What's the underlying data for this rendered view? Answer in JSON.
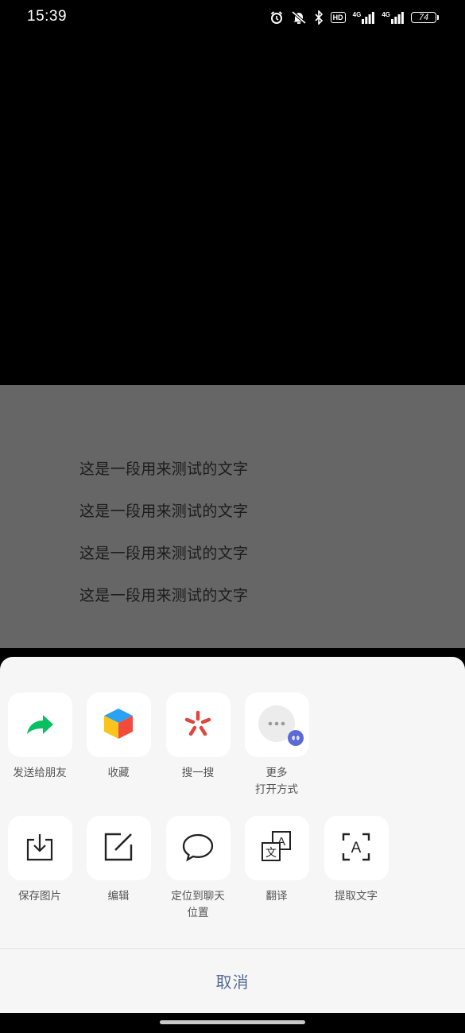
{
  "status_bar": {
    "time": "15:39",
    "network_1": "4G",
    "network_2": "4G",
    "hd": "HD",
    "battery": "74"
  },
  "preview": {
    "lines": [
      "这是一段用来测试的文字",
      "这是一段用来测试的文字",
      "这是一段用来测试的文字",
      "这是一段用来测试的文字"
    ]
  },
  "sheet": {
    "row1": [
      {
        "label": "发送给朋友",
        "icon": "share-arrow-icon"
      },
      {
        "label": "收藏",
        "icon": "favorite-cube-icon"
      },
      {
        "label": "搜一搜",
        "icon": "search-star-icon"
      },
      {
        "label": "更多\n打开方式",
        "icon": "more-icon"
      }
    ],
    "row2": [
      {
        "label": "保存图片",
        "icon": "download-icon"
      },
      {
        "label": "编辑",
        "icon": "edit-icon"
      },
      {
        "label": "定位到聊天\n位置",
        "icon": "chat-bubble-icon"
      },
      {
        "label": "翻译",
        "icon": "translate-icon"
      },
      {
        "label": "提取文字",
        "icon": "extract-text-icon"
      }
    ],
    "cancel": "取消"
  },
  "colors": {
    "sheet_bg": "#f6f6f6",
    "overlay": "#666666",
    "cancel_text": "#576b95",
    "share_green": "#07c160"
  }
}
